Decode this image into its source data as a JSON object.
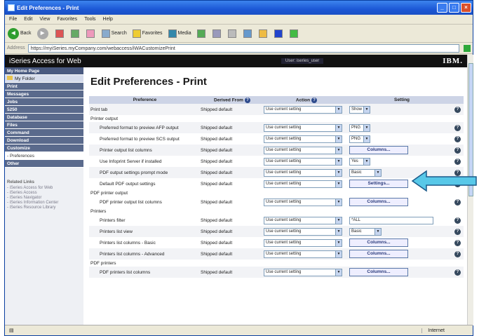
{
  "window": {
    "title": "Edit Preferences - Print"
  },
  "menu": [
    "File",
    "Edit",
    "View",
    "Favorites",
    "Tools",
    "Help"
  ],
  "toolbar": {
    "back": "Back",
    "search": "Search",
    "favorites": "Favorites",
    "media": "Media"
  },
  "address": {
    "label": "Address",
    "url": "https://myiSeries.myCompany.com/webaccess/iWACustomizePrint"
  },
  "banner": {
    "app": "iSeries Access for Web",
    "user": "User: iseries_user",
    "logo": "IBM."
  },
  "sidebar": {
    "items": [
      {
        "label": "My Home Page",
        "style": "head"
      },
      {
        "label": "My Folder",
        "style": "light fold"
      },
      {
        "label": "Print",
        "style": ""
      },
      {
        "label": "Messages",
        "style": ""
      },
      {
        "label": "Jobs",
        "style": ""
      },
      {
        "label": "5250",
        "style": ""
      },
      {
        "label": "Database",
        "style": ""
      },
      {
        "label": "Files",
        "style": ""
      },
      {
        "label": "Command",
        "style": ""
      },
      {
        "label": "Download",
        "style": ""
      },
      {
        "label": "Customize",
        "style": ""
      },
      {
        "label": "- Preferences",
        "style": "sub"
      },
      {
        "label": "Other",
        "style": ""
      }
    ],
    "related_title": "Related Links",
    "related": [
      "- iSeries Access for Web",
      "- iSeries Access",
      "- iSeries Navigator",
      "- iSeries Information Center",
      "- iSeries Resource Library"
    ]
  },
  "page": {
    "title": "Edit Preferences - Print"
  },
  "table": {
    "headers": [
      "Preference",
      "Derived From",
      "Action",
      "Setting"
    ],
    "rows": [
      {
        "type": "row",
        "pref": "Print tab",
        "derived": "Shipped default",
        "action": "Use current setting",
        "kind": "select",
        "setting": "Show"
      },
      {
        "type": "section",
        "pref": "Printer output"
      },
      {
        "type": "row",
        "indent": true,
        "pref": "Preferred format to preview AFP output",
        "derived": "Shipped default",
        "action": "Use current setting",
        "kind": "select",
        "setting": "PNG"
      },
      {
        "type": "row",
        "indent": true,
        "pref": "Preferred format to preview SCS output",
        "derived": "Shipped default",
        "action": "Use current setting",
        "kind": "select",
        "setting": "PNG"
      },
      {
        "type": "row",
        "indent": true,
        "pref": "Printer output list columns",
        "derived": "Shipped default",
        "action": "Use current setting",
        "kind": "button",
        "setting": "Columns..."
      },
      {
        "type": "row",
        "indent": true,
        "pref": "Use Infoprint Server if installed",
        "derived": "Shipped default",
        "action": "Use current setting",
        "kind": "select",
        "setting": "Yes"
      },
      {
        "type": "row",
        "indent": true,
        "pref": "PDF output settings prompt mode",
        "derived": "Shipped default",
        "action": "Use current setting",
        "kind": "select",
        "setting": "Basic"
      },
      {
        "type": "row",
        "indent": true,
        "pref": "Default PDF output settings",
        "derived": "Shipped default",
        "action": "Use current setting",
        "kind": "button",
        "setting": "Settings..."
      },
      {
        "type": "section",
        "pref": "PDF printer output"
      },
      {
        "type": "row",
        "indent": true,
        "pref": "PDF printer output list columns",
        "derived": "Shipped default",
        "action": "Use current setting",
        "kind": "button",
        "setting": "Columns..."
      },
      {
        "type": "section",
        "pref": "Printers"
      },
      {
        "type": "row",
        "indent": true,
        "pref": "Printers filter",
        "derived": "Shipped default",
        "action": "Use current setting",
        "kind": "text",
        "setting": "*ALL"
      },
      {
        "type": "row",
        "indent": true,
        "pref": "Printers list view",
        "derived": "Shipped default",
        "action": "Use current setting",
        "kind": "select",
        "setting": "Basic"
      },
      {
        "type": "row",
        "indent": true,
        "pref": "Printers list columns - Basic",
        "derived": "Shipped default",
        "action": "Use current setting",
        "kind": "button",
        "setting": "Columns..."
      },
      {
        "type": "row",
        "indent": true,
        "pref": "Printers list columns - Advanced",
        "derived": "Shipped default",
        "action": "Use current setting",
        "kind": "button",
        "setting": "Columns..."
      },
      {
        "type": "section",
        "pref": "PDF printers"
      },
      {
        "type": "row",
        "indent": true,
        "pref": "PDF printers list columns",
        "derived": "Shipped default",
        "action": "Use current setting",
        "kind": "button",
        "setting": "Columns..."
      }
    ]
  },
  "status": {
    "zone": "Internet"
  },
  "colors": {
    "highlight_arrow": "#58c8e8",
    "banner": "#111111",
    "nav": "#5a6a8c"
  }
}
